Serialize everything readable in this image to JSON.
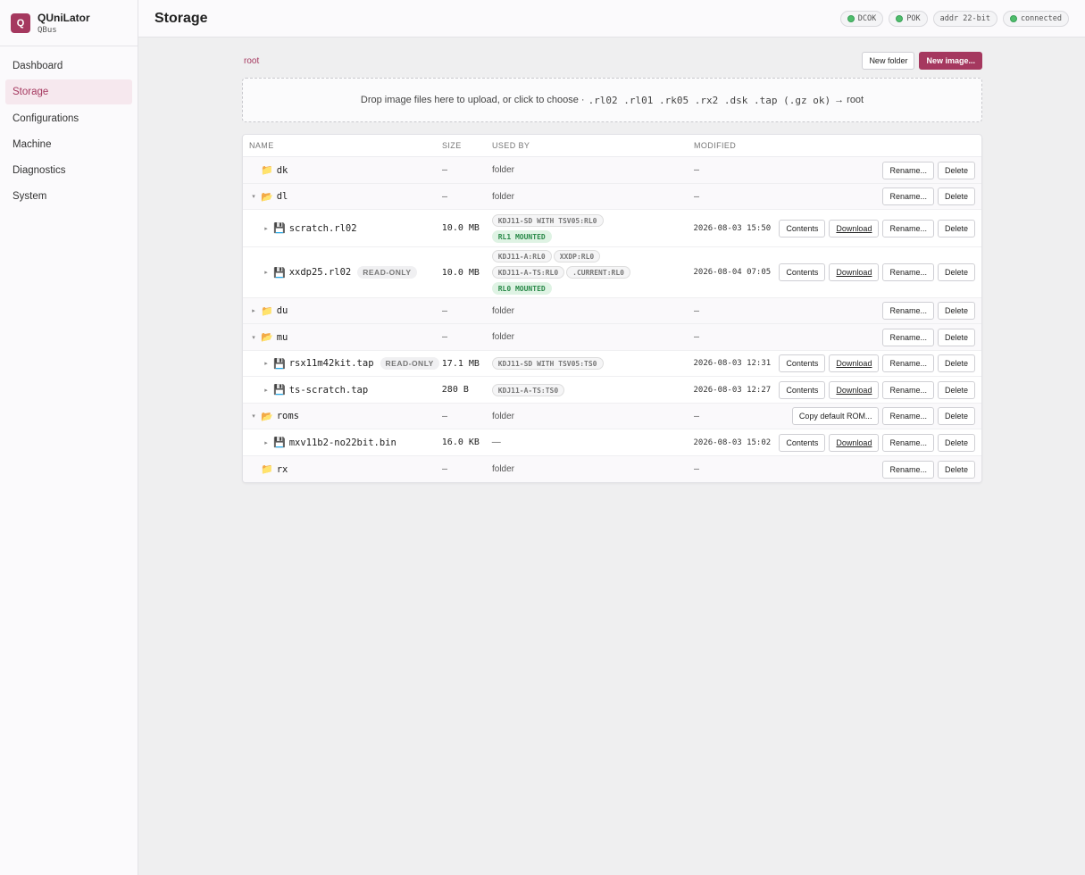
{
  "app": {
    "name": "QUniLator",
    "subtitle": "QBus",
    "logo_letter": "Q",
    "accent": "#a5385f"
  },
  "sidebar": {
    "items": [
      {
        "label": "Dashboard"
      },
      {
        "label": "Storage"
      },
      {
        "label": "Configurations"
      },
      {
        "label": "Machine"
      },
      {
        "label": "Diagnostics"
      },
      {
        "label": "System"
      }
    ],
    "active": "Storage"
  },
  "header": {
    "title": "Storage",
    "status": [
      {
        "label": "DCOK",
        "indicator": true
      },
      {
        "label": "POK",
        "indicator": true
      },
      {
        "label": "addr 22-bit",
        "indicator": false
      },
      {
        "label": "connected",
        "indicator": true
      }
    ]
  },
  "toolbar": {
    "breadcrumb": "root",
    "new_folder": "New folder",
    "new_image": "New image..."
  },
  "dropzone": {
    "text": "Drop image files here to upload, or click to choose ·",
    "extensions": ".rl02 .rl01 .rk05 .rx2 .dsk .tap (.gz ok)",
    "target": "→ root"
  },
  "table": {
    "headers": {
      "name": "NAME",
      "size": "SIZE",
      "used_by": "USED BY",
      "modified": "MODIFIED"
    },
    "buttons": {
      "rename": "Rename...",
      "delete": "Delete",
      "contents": "Contents",
      "download": "Download",
      "copy_rom": "Copy default ROM..."
    },
    "folder_label": "folder",
    "empty": "—",
    "read_only": "READ-ONLY",
    "rows": [
      {
        "name": "dk",
        "kind": "folder",
        "size": "—",
        "modified": "—"
      },
      {
        "name": "dl",
        "kind": "folder",
        "size": "—",
        "modified": "—"
      },
      {
        "name": "scratch.rl02",
        "kind": "file",
        "size": "10.0 MB",
        "tags": [
          "KDJ11-SD WITH TSV05:RL0"
        ],
        "mounted": "RL1 MOUNTED",
        "modified": "2026-08-03 15:50"
      },
      {
        "name": "xxdp25.rl02",
        "kind": "file",
        "readonly": true,
        "size": "10.0 MB",
        "tags": [
          "KDJ11-A:RL0",
          "XXDP:RL0",
          "KDJ11-A-TS:RL0",
          ".CURRENT:RL0"
        ],
        "mounted": "RL0 MOUNTED",
        "modified": "2026-08-04 07:05"
      },
      {
        "name": "du",
        "kind": "folder",
        "size": "—",
        "modified": "—"
      },
      {
        "name": "mu",
        "kind": "folder",
        "size": "—",
        "modified": "—"
      },
      {
        "name": "rsx11m42kit.tap",
        "kind": "file",
        "readonly": true,
        "size": "17.1 MB",
        "tags": [
          "KDJ11-SD WITH TSV05:TS0"
        ],
        "modified": "2026-08-03 12:31"
      },
      {
        "name": "ts-scratch.tap",
        "kind": "file",
        "size": "280 B",
        "tags": [
          "KDJ11-A-TS:TS0"
        ],
        "modified": "2026-08-03 12:27"
      },
      {
        "name": "roms",
        "kind": "folder",
        "size": "—",
        "modified": "—"
      },
      {
        "name": "mxv11b2-no22bit.bin",
        "kind": "file",
        "size": "16.0 KB",
        "used_none": "—",
        "modified": "2026-08-03 15:02"
      },
      {
        "name": "rx",
        "kind": "folder",
        "size": "—",
        "modified": "—"
      }
    ]
  },
  "icons": {
    "folder": "folder-icon",
    "file": "floppy-disk-icon",
    "caret_right": "caret-right-icon",
    "caret_down": "caret-down-icon"
  }
}
